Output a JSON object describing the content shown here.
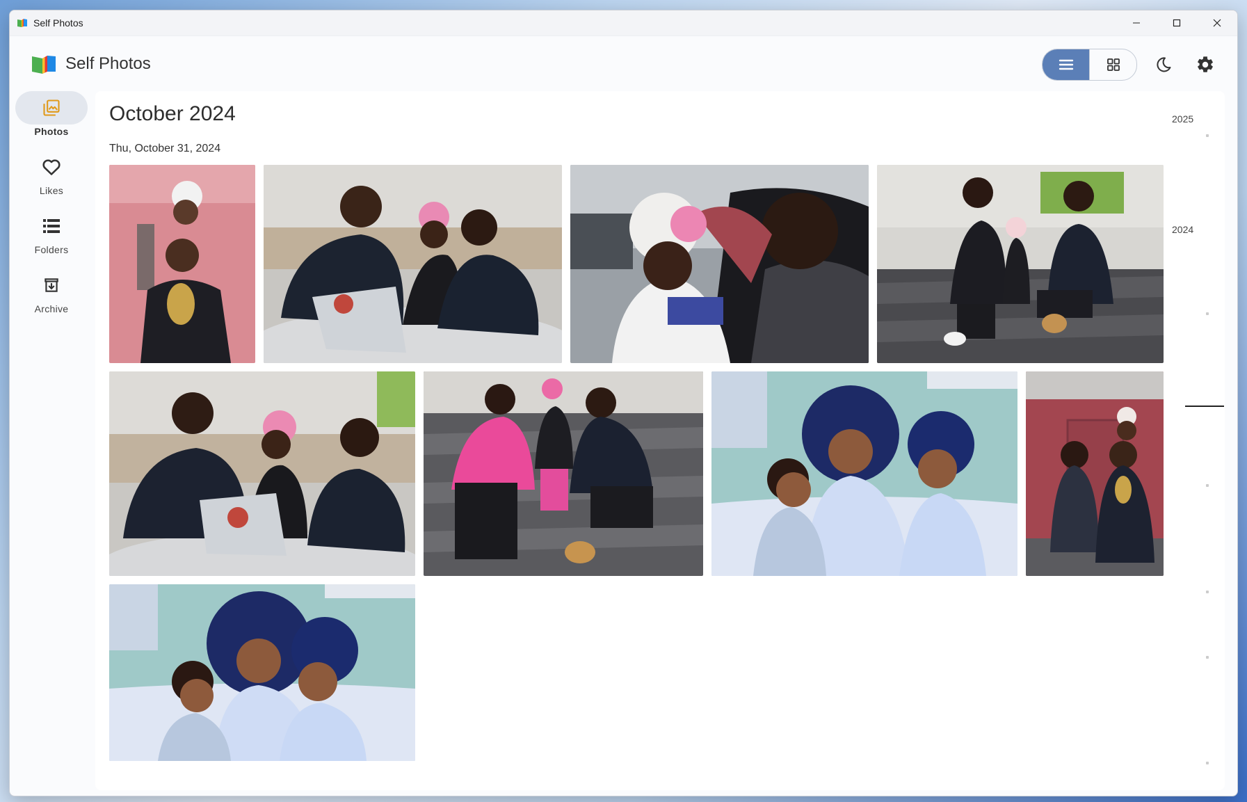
{
  "window": {
    "title": "Self Photos"
  },
  "app": {
    "title": "Self Photos"
  },
  "header": {
    "view_toggle": [
      "list-view",
      "grid-view"
    ],
    "active_view": "list-view",
    "accent_color": "#5b7fb7"
  },
  "sidebar": {
    "items": [
      {
        "label": "Photos",
        "icon": "photos-icon",
        "active": true
      },
      {
        "label": "Likes",
        "icon": "heart-icon",
        "active": false
      },
      {
        "label": "Folders",
        "icon": "folders-icon",
        "active": false
      },
      {
        "label": "Archive",
        "icon": "archive-icon",
        "active": false
      }
    ]
  },
  "main": {
    "month_title": "October 2024",
    "date_label": "Thu, October 31, 2024",
    "photo_count": 9
  },
  "timeline": {
    "years": [
      "2025",
      "2024"
    ]
  }
}
